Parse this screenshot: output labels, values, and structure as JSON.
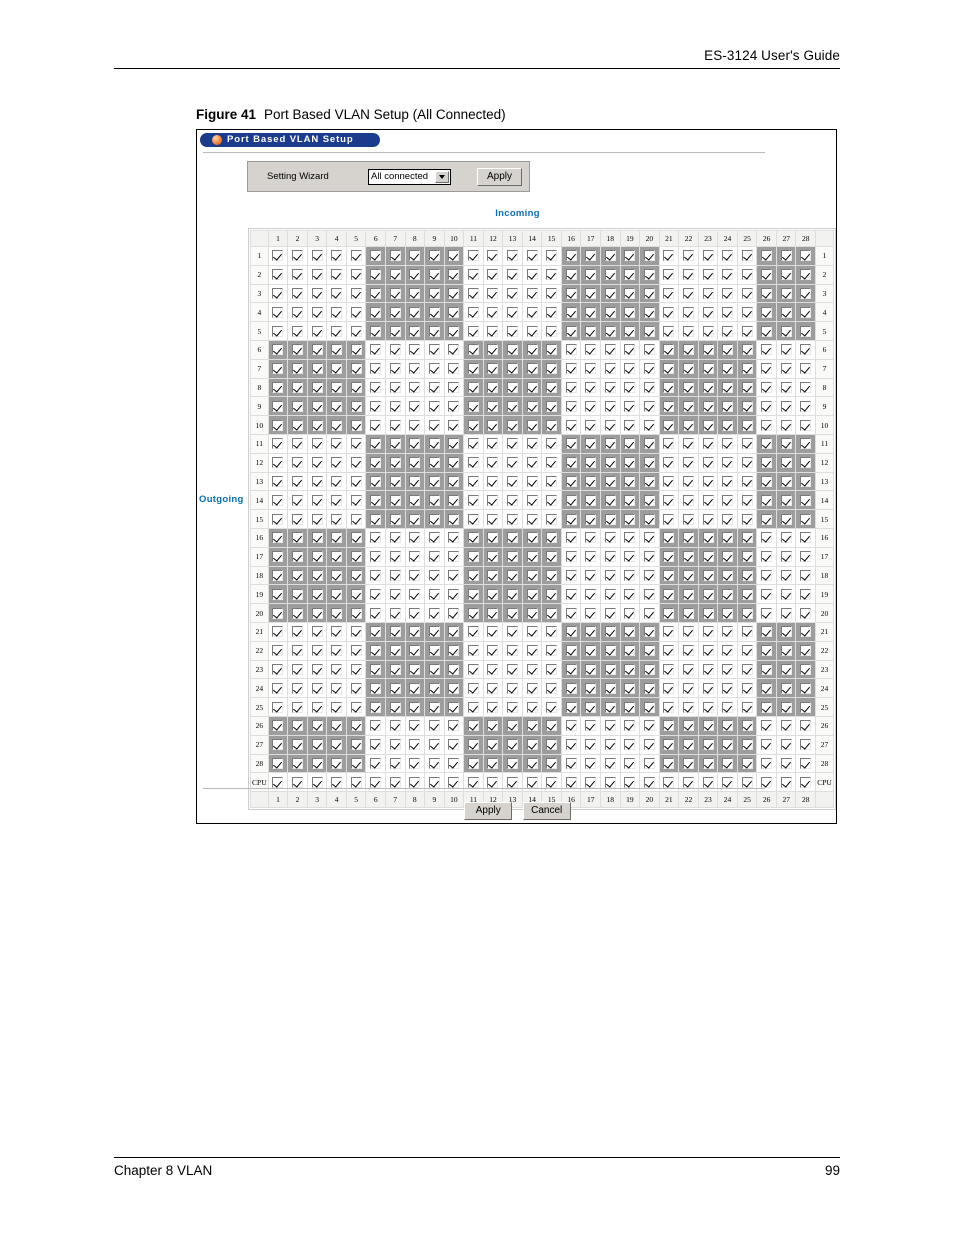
{
  "page": {
    "header_title": "ES-3124 User's Guide",
    "footer_left": "Chapter 8 VLAN",
    "footer_page": "99"
  },
  "figure": {
    "number": "Figure 41",
    "title": "Port Based VLAN Setup (All Connected)"
  },
  "screen": {
    "title_bar": {
      "label": "Port Based VLAN Setup",
      "orb_icon": "orange-orb-icon",
      "bg_color": "#1b3c8c",
      "text_color": "#ffffff"
    },
    "wizard": {
      "label": "Setting Wizard",
      "select_value": "All connected",
      "select_options": [
        "All connected"
      ],
      "apply_label": "Apply"
    },
    "matrix": {
      "incoming_label": "Incoming",
      "outgoing_label": "Outgoing",
      "accent_color": "#0a6fb5",
      "shade_color": "#9d9d9d",
      "checkbox_icon": "checkbox-checked-icon",
      "port_count": 28,
      "block_size": 5,
      "column_headers": [
        "1",
        "2",
        "3",
        "4",
        "5",
        "6",
        "7",
        "8",
        "9",
        "10",
        "11",
        "12",
        "13",
        "14",
        "15",
        "16",
        "17",
        "18",
        "19",
        "20",
        "21",
        "22",
        "23",
        "24",
        "25",
        "26",
        "27",
        "28"
      ],
      "row_labels": [
        "1",
        "2",
        "3",
        "4",
        "5",
        "6",
        "7",
        "8",
        "9",
        "10",
        "11",
        "12",
        "13",
        "14",
        "15",
        "16",
        "17",
        "18",
        "19",
        "20",
        "21",
        "22",
        "23",
        "24",
        "25",
        "26",
        "27",
        "28",
        "CPU"
      ],
      "footer_headers": [
        "1",
        "2",
        "3",
        "4",
        "5",
        "6",
        "7",
        "8",
        "9",
        "10",
        "11",
        "12",
        "13",
        "14",
        "15",
        "16",
        "17",
        "18",
        "19",
        "20",
        "21",
        "22",
        "23",
        "24",
        "25",
        "26",
        "27",
        "28"
      ],
      "all_checked": true
    },
    "buttons": {
      "apply_label": "Apply",
      "cancel_label": "Cancel"
    }
  }
}
